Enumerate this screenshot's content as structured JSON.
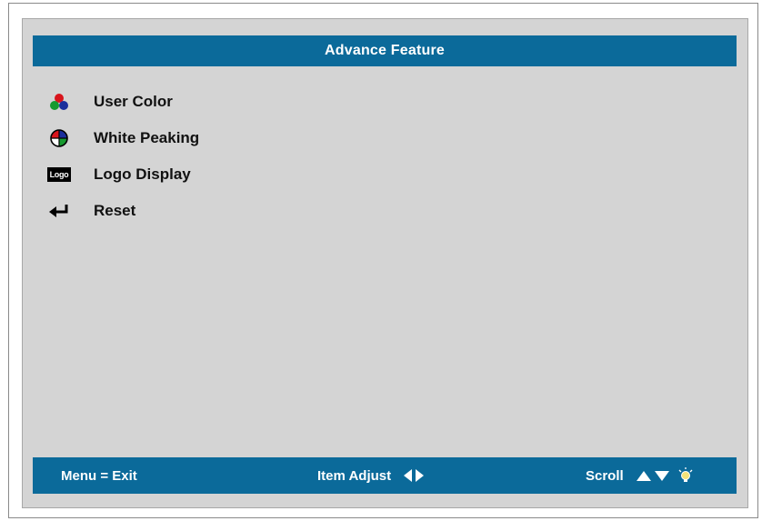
{
  "header": {
    "title": "Advance Feature"
  },
  "menu": {
    "items": [
      {
        "label": "User Color",
        "icon": "rgb-dots-icon"
      },
      {
        "label": "White Peaking",
        "icon": "color-wheel-icon"
      },
      {
        "label": "Logo Display",
        "icon": "logo-icon",
        "icon_text": "Logo"
      },
      {
        "label": "Reset",
        "icon": "enter-arrow-icon"
      }
    ]
  },
  "footer": {
    "exit_label": "Menu = Exit",
    "adjust_label": "Item Adjust",
    "scroll_label": "Scroll"
  },
  "colors": {
    "bar": "#0b6a9a",
    "panel": "#d4d4d4",
    "text": "#111111"
  }
}
